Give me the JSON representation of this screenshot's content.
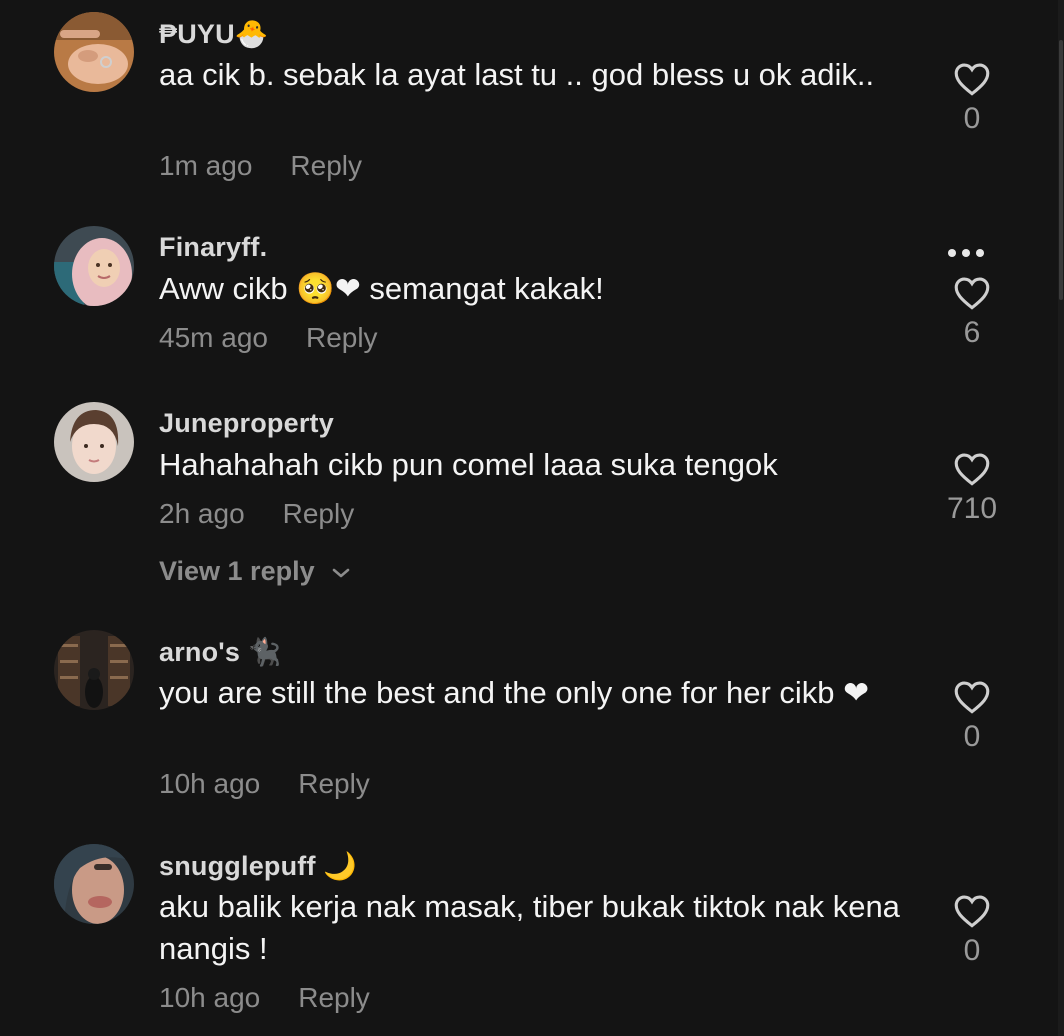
{
  "colors": {
    "background": "#141414",
    "username": "#d9d9d9",
    "meta": "#8c8c8c",
    "text": "#f4f4f4"
  },
  "comments": [
    {
      "username": "₱UYU🐣",
      "text": "aa cik b. sebak la ayat last tu .. god bless u ok adik..",
      "time": "1m ago",
      "reply": "Reply",
      "likes": "0",
      "avatar_icon": "hand-ring-avatar"
    },
    {
      "username": "Finaryff.",
      "text": "Aww cikb 🥺❤ semangat kakak!",
      "time": "45m ago",
      "reply": "Reply",
      "likes": "6",
      "avatar_icon": "hijab-woman-avatar",
      "more_icon": "more-dots-icon"
    },
    {
      "username": "Juneproperty",
      "text": "Hahahahah cikb pun comel laaa suka tengok",
      "time": "2h ago",
      "reply": "Reply",
      "likes": "710",
      "avatar_icon": "woman-portrait-avatar",
      "view_replies": "View 1 reply"
    },
    {
      "username": "arno's 🐈‍⬛",
      "text": "you are still the best and the only one for her cikb ❤",
      "time": "10h ago",
      "reply": "Reply",
      "likes": "0",
      "avatar_icon": "bookshelf-avatar"
    },
    {
      "username": "snugglepuff 🌙",
      "text": "aku balik kerja nak masak, tiber bukak tiktok nak kena nangis !",
      "time": "10h ago",
      "reply": "Reply",
      "likes": "0",
      "avatar_icon": "face-closeup-avatar"
    }
  ]
}
